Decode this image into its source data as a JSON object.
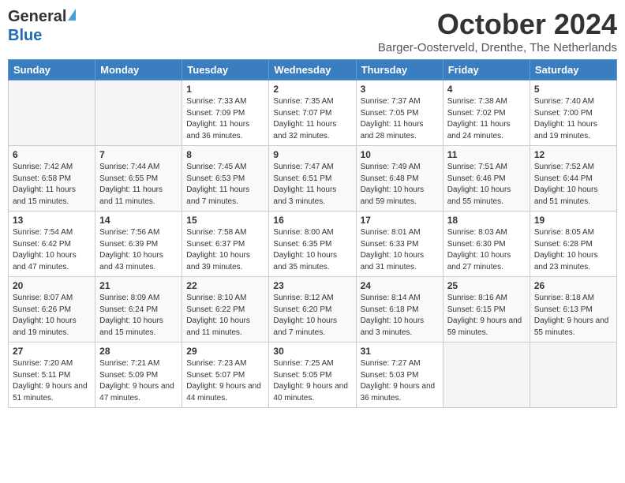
{
  "header": {
    "logo_general": "General",
    "logo_blue": "Blue",
    "month_title": "October 2024",
    "location": "Barger-Oosterveld, Drenthe, The Netherlands"
  },
  "days_of_week": [
    "Sunday",
    "Monday",
    "Tuesday",
    "Wednesday",
    "Thursday",
    "Friday",
    "Saturday"
  ],
  "weeks": [
    [
      {
        "day": "",
        "info": ""
      },
      {
        "day": "",
        "info": ""
      },
      {
        "day": "1",
        "info": "Sunrise: 7:33 AM\nSunset: 7:09 PM\nDaylight: 11 hours and 36 minutes."
      },
      {
        "day": "2",
        "info": "Sunrise: 7:35 AM\nSunset: 7:07 PM\nDaylight: 11 hours and 32 minutes."
      },
      {
        "day": "3",
        "info": "Sunrise: 7:37 AM\nSunset: 7:05 PM\nDaylight: 11 hours and 28 minutes."
      },
      {
        "day": "4",
        "info": "Sunrise: 7:38 AM\nSunset: 7:02 PM\nDaylight: 11 hours and 24 minutes."
      },
      {
        "day": "5",
        "info": "Sunrise: 7:40 AM\nSunset: 7:00 PM\nDaylight: 11 hours and 19 minutes."
      }
    ],
    [
      {
        "day": "6",
        "info": "Sunrise: 7:42 AM\nSunset: 6:58 PM\nDaylight: 11 hours and 15 minutes."
      },
      {
        "day": "7",
        "info": "Sunrise: 7:44 AM\nSunset: 6:55 PM\nDaylight: 11 hours and 11 minutes."
      },
      {
        "day": "8",
        "info": "Sunrise: 7:45 AM\nSunset: 6:53 PM\nDaylight: 11 hours and 7 minutes."
      },
      {
        "day": "9",
        "info": "Sunrise: 7:47 AM\nSunset: 6:51 PM\nDaylight: 11 hours and 3 minutes."
      },
      {
        "day": "10",
        "info": "Sunrise: 7:49 AM\nSunset: 6:48 PM\nDaylight: 10 hours and 59 minutes."
      },
      {
        "day": "11",
        "info": "Sunrise: 7:51 AM\nSunset: 6:46 PM\nDaylight: 10 hours and 55 minutes."
      },
      {
        "day": "12",
        "info": "Sunrise: 7:52 AM\nSunset: 6:44 PM\nDaylight: 10 hours and 51 minutes."
      }
    ],
    [
      {
        "day": "13",
        "info": "Sunrise: 7:54 AM\nSunset: 6:42 PM\nDaylight: 10 hours and 47 minutes."
      },
      {
        "day": "14",
        "info": "Sunrise: 7:56 AM\nSunset: 6:39 PM\nDaylight: 10 hours and 43 minutes."
      },
      {
        "day": "15",
        "info": "Sunrise: 7:58 AM\nSunset: 6:37 PM\nDaylight: 10 hours and 39 minutes."
      },
      {
        "day": "16",
        "info": "Sunrise: 8:00 AM\nSunset: 6:35 PM\nDaylight: 10 hours and 35 minutes."
      },
      {
        "day": "17",
        "info": "Sunrise: 8:01 AM\nSunset: 6:33 PM\nDaylight: 10 hours and 31 minutes."
      },
      {
        "day": "18",
        "info": "Sunrise: 8:03 AM\nSunset: 6:30 PM\nDaylight: 10 hours and 27 minutes."
      },
      {
        "day": "19",
        "info": "Sunrise: 8:05 AM\nSunset: 6:28 PM\nDaylight: 10 hours and 23 minutes."
      }
    ],
    [
      {
        "day": "20",
        "info": "Sunrise: 8:07 AM\nSunset: 6:26 PM\nDaylight: 10 hours and 19 minutes."
      },
      {
        "day": "21",
        "info": "Sunrise: 8:09 AM\nSunset: 6:24 PM\nDaylight: 10 hours and 15 minutes."
      },
      {
        "day": "22",
        "info": "Sunrise: 8:10 AM\nSunset: 6:22 PM\nDaylight: 10 hours and 11 minutes."
      },
      {
        "day": "23",
        "info": "Sunrise: 8:12 AM\nSunset: 6:20 PM\nDaylight: 10 hours and 7 minutes."
      },
      {
        "day": "24",
        "info": "Sunrise: 8:14 AM\nSunset: 6:18 PM\nDaylight: 10 hours and 3 minutes."
      },
      {
        "day": "25",
        "info": "Sunrise: 8:16 AM\nSunset: 6:15 PM\nDaylight: 9 hours and 59 minutes."
      },
      {
        "day": "26",
        "info": "Sunrise: 8:18 AM\nSunset: 6:13 PM\nDaylight: 9 hours and 55 minutes."
      }
    ],
    [
      {
        "day": "27",
        "info": "Sunrise: 7:20 AM\nSunset: 5:11 PM\nDaylight: 9 hours and 51 minutes."
      },
      {
        "day": "28",
        "info": "Sunrise: 7:21 AM\nSunset: 5:09 PM\nDaylight: 9 hours and 47 minutes."
      },
      {
        "day": "29",
        "info": "Sunrise: 7:23 AM\nSunset: 5:07 PM\nDaylight: 9 hours and 44 minutes."
      },
      {
        "day": "30",
        "info": "Sunrise: 7:25 AM\nSunset: 5:05 PM\nDaylight: 9 hours and 40 minutes."
      },
      {
        "day": "31",
        "info": "Sunrise: 7:27 AM\nSunset: 5:03 PM\nDaylight: 9 hours and 36 minutes."
      },
      {
        "day": "",
        "info": ""
      },
      {
        "day": "",
        "info": ""
      }
    ]
  ]
}
